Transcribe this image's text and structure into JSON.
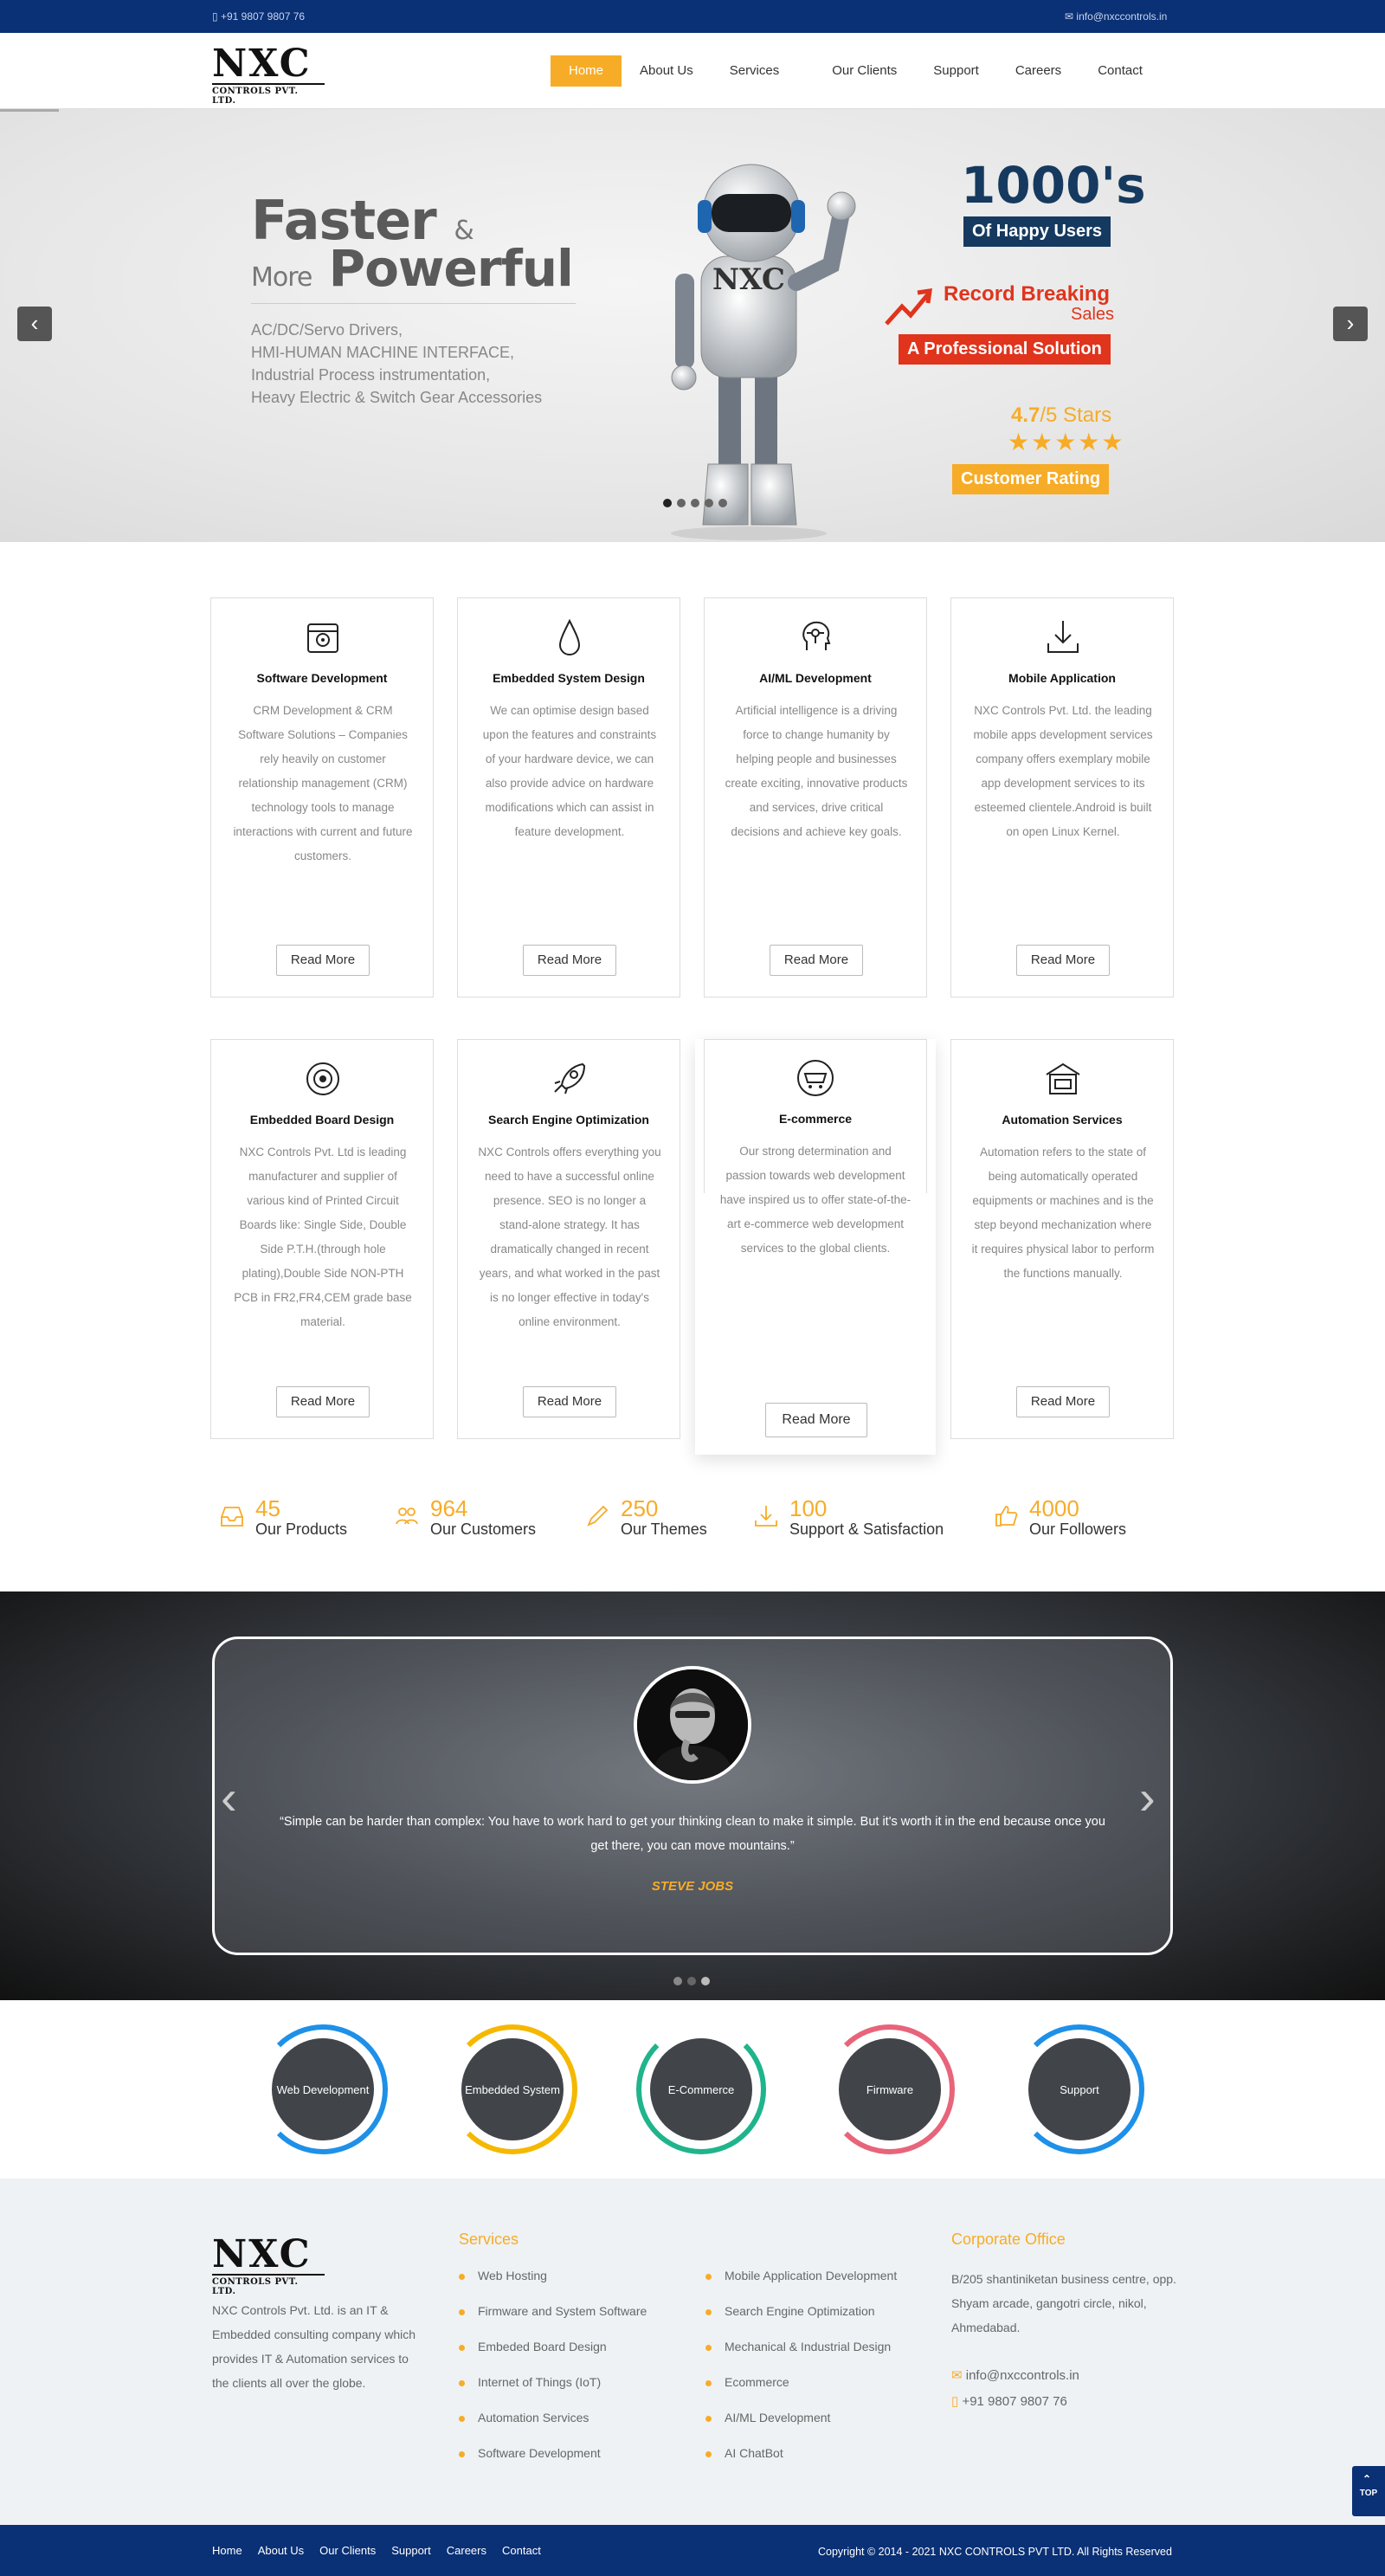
{
  "topbar": {
    "phone": "+91 9807 9807 76",
    "email": "info@nxccontrols.in"
  },
  "logo": {
    "main": "NXC",
    "sub": "CONTROLS PVT. LTD."
  },
  "nav": [
    "Home",
    "About Us",
    "Services",
    "Our Clients",
    "Support",
    "Careers",
    "Contact"
  ],
  "hero": {
    "line1_big": "Faster",
    "line1_small": "&",
    "line2_small": "More",
    "line2_big": "Powerful",
    "subtitle": [
      "AC/DC/Servo Drivers,",
      "HMI-HUMAN MACHINE INTERFACE,",
      "Industrial Process instrumentation,",
      "Heavy Electric & Switch Gear Accessories"
    ],
    "robot_label": "NXC",
    "users_count": "1000's",
    "users_tag": "Of Happy Users",
    "record": "Record Breaking",
    "record_sub": "Sales",
    "professional": "A Professional Solution",
    "rating_value": "4.7",
    "rating_scale": "/5 Stars",
    "stars": "★★★★★",
    "rating_tag": "Customer Rating",
    "prev": "‹",
    "next": "›"
  },
  "services": [
    {
      "icon": "software-icon",
      "title": "Software Development",
      "text": "CRM Development & CRM Software Solutions – Companies rely heavily on customer relationship management (CRM) technology tools to manage interactions with current and future customers.",
      "button": "Read More"
    },
    {
      "icon": "drop-icon",
      "title": "Embedded System Design",
      "text": "We can optimise design based upon the features and constraints of your hardware device, we can also provide advice on hardware modifications which can assist in feature development.",
      "button": "Read More"
    },
    {
      "icon": "ai-head-icon",
      "title": "AI/ML Development",
      "text": "Artificial intelligence is a driving force to change humanity by helping people and businesses create exciting, innovative products and services, drive critical decisions and achieve key goals.",
      "button": "Read More"
    },
    {
      "icon": "download-icon",
      "title": "Mobile Application",
      "text": "NXC Controls Pvt. Ltd. the leading mobile apps development services company offers exemplary mobile app development services to its esteemed clientele.Android is built on open Linux Kernel.",
      "button": "Read More"
    },
    {
      "icon": "board-icon",
      "title": "Embedded Board Design",
      "text": "NXC Controls Pvt. Ltd is leading manufacturer and supplier of various kind of Printed Circuit Boards like: Single Side, Double Side P.T.H.(through hole plating),Double Side NON-PTH PCB in FR2,FR4,CEM grade base material.",
      "button": "Read More"
    },
    {
      "icon": "rocket-icon",
      "title": "Search Engine Optimization",
      "text": "NXC Controls offers everything you need to have a successful online presence. SEO is no longer a stand-alone strategy. It has dramatically changed in recent years, and what worked in the past is no longer effective in today's online environment.",
      "button": "Read More"
    },
    {
      "icon": "ecommerce-icon",
      "title": "E-commerce",
      "text": "Our strong determination and passion towards web development have inspired us to offer state-of-the-art e-commerce web development services to the global clients.",
      "button": "Read More"
    },
    {
      "icon": "factory-icon",
      "title": "Automation Services",
      "text": "Automation refers to the state of being automatically operated equipments or machines and is the step beyond mechanization where it requires physical labor to perform the functions manually.",
      "button": "Read More"
    }
  ],
  "stats": [
    {
      "icon": "inbox-icon",
      "number": "45",
      "label": "Our Products"
    },
    {
      "icon": "users-icon",
      "number": "964",
      "label": "Our Customers"
    },
    {
      "icon": "pencil-icon",
      "number": "250",
      "label": "Our Themes"
    },
    {
      "icon": "download-icon",
      "number": "100",
      "label": "Support & Satisfaction"
    },
    {
      "icon": "thumbs-up-icon",
      "number": "4000",
      "label": "Our Followers"
    }
  ],
  "testimonial": {
    "quote": "“Simple can be harder than complex: You have to work hard to get your thinking clean to make it simple. But it's worth it in the end because once you get there, you can move mountains.”",
    "author": "STEVE JOBS",
    "prev": "‹",
    "next": "›"
  },
  "circles": [
    {
      "label": "Web Development",
      "color": "#1e90e8"
    },
    {
      "label": "Embedded System",
      "color": "#f5b800"
    },
    {
      "label": "E-Commerce",
      "color": "#1fb48c"
    },
    {
      "label": "Firmware",
      "color": "#e8647a"
    },
    {
      "label": "Support",
      "color": "#1e90e8"
    }
  ],
  "footer": {
    "about": "NXC Controls Pvt. Ltd. is an IT & Embedded consulting company which provides IT & Automation services to the clients all over the globe.",
    "services_title": "Services",
    "services_col1": [
      "Web Hosting",
      "Firmware and System Software",
      "Embeded Board Design",
      "Internet of Things (IoT)",
      "Automation Services",
      "Software Development"
    ],
    "services_col2": [
      "Mobile Application Development",
      "Search Engine Optimization",
      "Mechanical & Industrial Design",
      "Ecommerce",
      "AI/ML Development",
      "AI ChatBot"
    ],
    "office_title": "Corporate Office",
    "address": "B/205 shantiniketan business centre, opp. Shyam arcade, gangotri circle, nikol, Ahmedabad.",
    "email": "info@nxccontrols.in",
    "phone": "+91 9807 9807 76"
  },
  "bottom": {
    "links": [
      "Home",
      "About Us",
      "Our Clients",
      "Support",
      "Careers",
      "Contact"
    ],
    "copyright": "Copyright © 2014 - 2021 NXC CONTROLS PVT LTD. All Rights Reserved"
  },
  "totop": "TOP",
  "colors": {
    "brand_blue": "#0a3075",
    "accent": "#f7ac27",
    "red": "#e0341c",
    "navy": "#163a5f"
  }
}
